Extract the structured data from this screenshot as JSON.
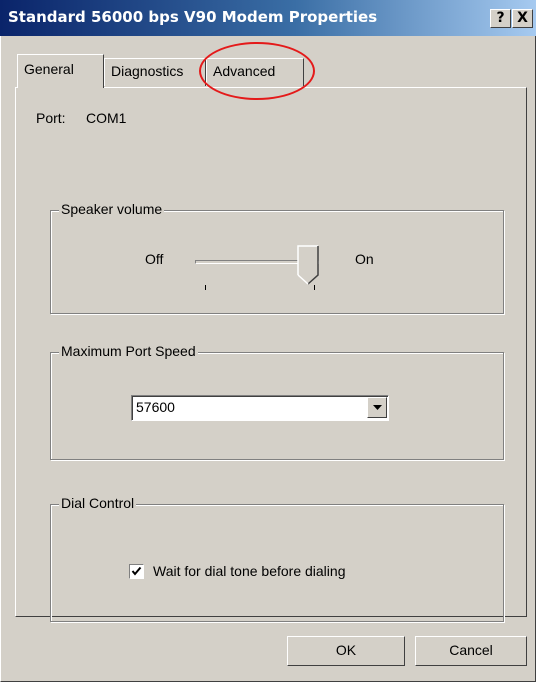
{
  "window": {
    "title": "Standard 56000 bps V90 Modem Properties"
  },
  "titlebar": {
    "help_label": "?",
    "close_label": "X"
  },
  "tabs": [
    {
      "label": "General",
      "active": true
    },
    {
      "label": "Diagnostics",
      "active": false
    },
    {
      "label": "Advanced",
      "active": false
    }
  ],
  "general": {
    "port_label": "Port:",
    "port_value": "COM1",
    "speaker": {
      "group_title": "Speaker volume",
      "min_label": "Off",
      "max_label": "On",
      "level": 0.9
    },
    "speed": {
      "group_title": "Maximum Port Speed",
      "selected": "57600"
    },
    "dial": {
      "group_title": "Dial Control",
      "checkbox_label": "Wait for dial tone before dialing",
      "checked": true
    }
  },
  "buttons": {
    "ok": "OK",
    "cancel": "Cancel"
  },
  "annotation": {
    "color": "#e41a1a",
    "target": "Advanced"
  }
}
